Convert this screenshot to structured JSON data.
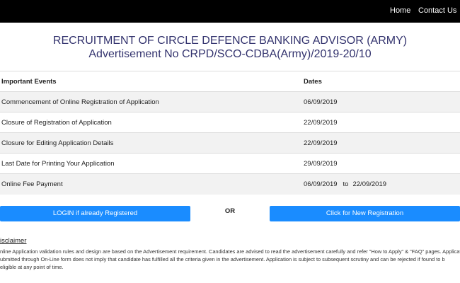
{
  "nav": {
    "home": "Home",
    "contact": "Contact Us"
  },
  "header": {
    "title_line1": "RECRUITMENT OF CIRCLE DEFENCE BANKING ADVISOR (ARMY)",
    "title_line2": "Advertisement No CRPD/SCO-CDBA(Army)/2019-20/10"
  },
  "events_table": {
    "columns": [
      "Important Events",
      "Dates"
    ],
    "rows": [
      {
        "event": "Commencement of Online Registration of Application",
        "date": "06/09/2019"
      },
      {
        "event": "Closure of Registration of Application",
        "date": "22/09/2019"
      },
      {
        "event": "Closure for Editing Application Details",
        "date": "22/09/2019"
      },
      {
        "event": "Last Date for Printing Your Application",
        "date": "29/09/2019"
      },
      {
        "event": "Online Fee Payment",
        "date_from": "06/09/2019",
        "to": "to",
        "date_to": "22/09/2019"
      }
    ]
  },
  "actions": {
    "login": "LOGIN if already Registered",
    "or": "OR",
    "register": "Click for New Registration"
  },
  "disclaimer": {
    "title": "isclaimer",
    "line1": "nline Application validation rules and design are based on the Advertisement requirement. Candidates are advised to read the advertisement carefully and refer \"How to Apply\" & \"FAQ\" pages. Applicati",
    "line2": "ubmitted through On-Line form does not imply that candidate has fulfilled all the criteria given in the advertisement. Application is subject to subsequent scrutiny and can be rejected if found to b",
    "line3": "eligible at any point of time."
  },
  "colors": {
    "topbar": "#000000",
    "title": "#33336e",
    "button": "#1a8cff",
    "row_alt": "#f2f2f2"
  }
}
